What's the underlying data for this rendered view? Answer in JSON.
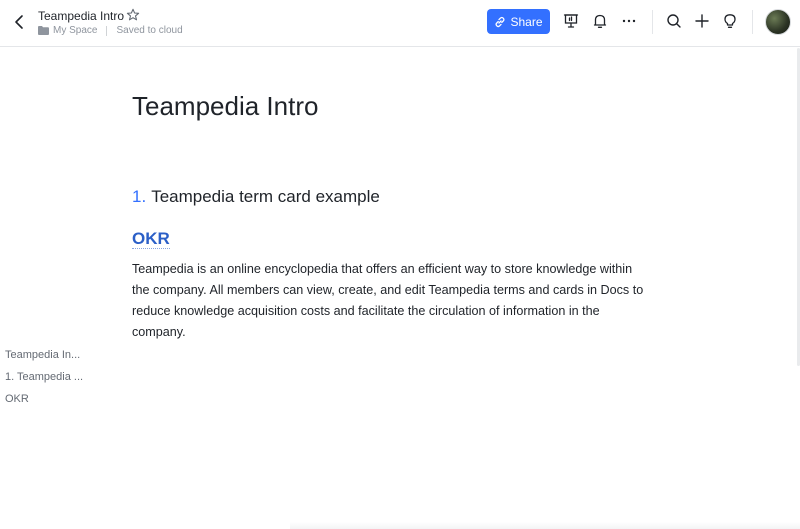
{
  "header": {
    "doc_title": "Teampedia Intro",
    "location": "My Space",
    "save_status": "Saved to cloud",
    "share_label": "Share"
  },
  "icons": {
    "back": "chevron-left-icon",
    "favorite": "star-icon",
    "folder": "folder-icon",
    "share": "link-icon",
    "present": "presentation-icon",
    "notifications": "bell-icon",
    "more": "more-horizontal-icon",
    "search": "search-icon",
    "new": "plus-icon",
    "help": "lightbulb-icon"
  },
  "colors": {
    "accent": "#3370ff",
    "term": "#2b5fc7"
  },
  "document": {
    "title": "Teampedia Intro",
    "heading1_number": "1.",
    "heading1_text": "Teampedia term card example",
    "term": "OKR",
    "paragraph": "Teampedia is an online encyclopedia that offers an efficient way to store knowledge within the company. All members can view, create, and edit Teampedia terms and cards in Docs to reduce knowledge acquisition costs and facilitate the circulation of information in the company."
  },
  "outline": {
    "items": [
      {
        "label": "Teampedia In..."
      },
      {
        "label": "1. Teampedia ..."
      },
      {
        "label": "OKR"
      }
    ]
  }
}
